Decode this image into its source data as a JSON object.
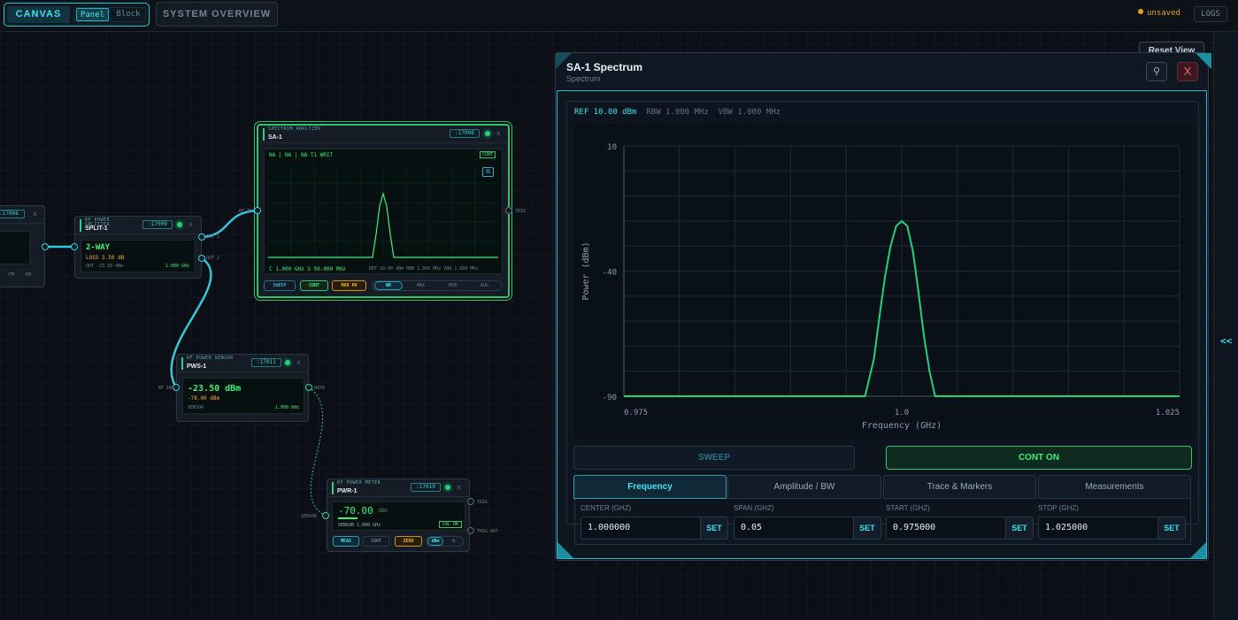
{
  "topbar": {
    "canvas_label": "CANVAS",
    "panel_label": "Panel",
    "block_label": "Block",
    "system_overview_label": "SYSTEM OVERVIEW",
    "unsaved_label": "unsaved",
    "logs_label": "LOGS"
  },
  "nodes": {
    "left_partial": {
      "port": ":17006",
      "close": "x",
      "btn_fm": "FM",
      "btn_pm": "PM"
    },
    "splitter": {
      "category": "RF POWER SPLITTER",
      "name": "SPLIT-1",
      "port": ":17009",
      "close": "x",
      "mode": "2-WAY",
      "loss": "LOSS 3.50 dB",
      "out": "OUT -23.50 dBm",
      "freq": "1.000 GHz",
      "out1_label": "OUT 1",
      "out2_label": "OUT 2"
    },
    "analyzer": {
      "category": "SPECTRUM ANALYZER",
      "name": "SA-1",
      "port": ":17008",
      "close": "x",
      "status": "NA | NA | NA T1 WRIT",
      "cont_badge": "CONT",
      "center_span": "C 1.000 GHz  S 50.000 MHz",
      "settings": "REF 10.00 dBm  RBW 1.000 MHz  VBW 1.000 MHz",
      "rf_in_label": "RF IN",
      "trig_label": "TRIG",
      "buttons": [
        "SWEEP",
        "CONT",
        "MKR PK"
      ],
      "trace_modes": [
        "WR",
        "MAX",
        "MIN",
        "AVG"
      ]
    },
    "sensor": {
      "category": "RF POWER SENSOR",
      "name": "PWS-1",
      "port": ":17011",
      "close": "x",
      "reading": "-23.50 dBm",
      "sub": "-78.00 dBm",
      "sensor_label": "SENSOR",
      "freq": "1.000 GHz",
      "rf_in_label": "RF IN",
      "data_label": "DATA"
    },
    "meter": {
      "category": "RF POWER METER",
      "name": "PWR-1",
      "port": ":17010",
      "close": "x",
      "reading": "-70.00",
      "unit": "dBm",
      "sensor_line": "SENSOR 1.000 GHz",
      "cal": "CAL OK",
      "buttons": [
        "MEAS",
        "CONT",
        "ZERO"
      ],
      "unit_toggle": [
        "dBm",
        "W"
      ],
      "sensor_in_label": "SENSOR",
      "trig_label": "TRIG",
      "trig_out_label": "TRIG OUT"
    }
  },
  "panel": {
    "reset_label": "Reset View",
    "title": "SA-1 Spectrum",
    "subtitle": "Spectrum",
    "pin_icon": "pin-icon",
    "close_label": "X",
    "ref": "REF 10.00 dBm",
    "rbw": "RBW 1.000 MHz",
    "vbw": "VBW 1.000 MHz",
    "sweep_label": "SWEEP",
    "cont_label": "CONT ON",
    "tabs": [
      "Frequency",
      "Amplitude / BW",
      "Trace & Markers",
      "Measurements"
    ],
    "fields": [
      {
        "label": "CENTER (GHZ)",
        "value": "1.000000",
        "set": "SET"
      },
      {
        "label": "SPAN (GHZ)",
        "value": "0.05",
        "set": "SET"
      },
      {
        "label": "START (GHZ)",
        "value": "0.975000",
        "set": "SET"
      },
      {
        "label": "STOP (GHZ)",
        "value": "1.025000",
        "set": "SET"
      }
    ],
    "side_toggle": "<<"
  },
  "chart_data": {
    "type": "line",
    "title": "",
    "xlabel": "Frequency (GHz)",
    "ylabel": "Power (dBm)",
    "xlim": [
      0.975,
      1.025
    ],
    "ylim": [
      -90,
      10
    ],
    "x_ticks": [
      "0.975",
      "1.0",
      "1.025"
    ],
    "y_ticks": [
      "10",
      "-40",
      "-90"
    ],
    "x_tick_values": [
      0.975,
      1.0,
      1.025
    ],
    "y_tick_values": [
      10,
      -40,
      -90
    ],
    "grid": true,
    "color": "#22d17a",
    "series": [
      {
        "x": [
          0.975,
          0.9967,
          0.9975,
          0.998,
          0.9985,
          0.999,
          0.9995,
          1.0,
          1.0005,
          1.001,
          1.0015,
          1.002,
          1.0025,
          1.003,
          1.025
        ],
        "values": [
          -90,
          -90,
          -75,
          -58,
          -42,
          -30,
          -22,
          -20,
          -22,
          -32,
          -48,
          -66,
          -80,
          -90,
          -90
        ]
      }
    ]
  }
}
